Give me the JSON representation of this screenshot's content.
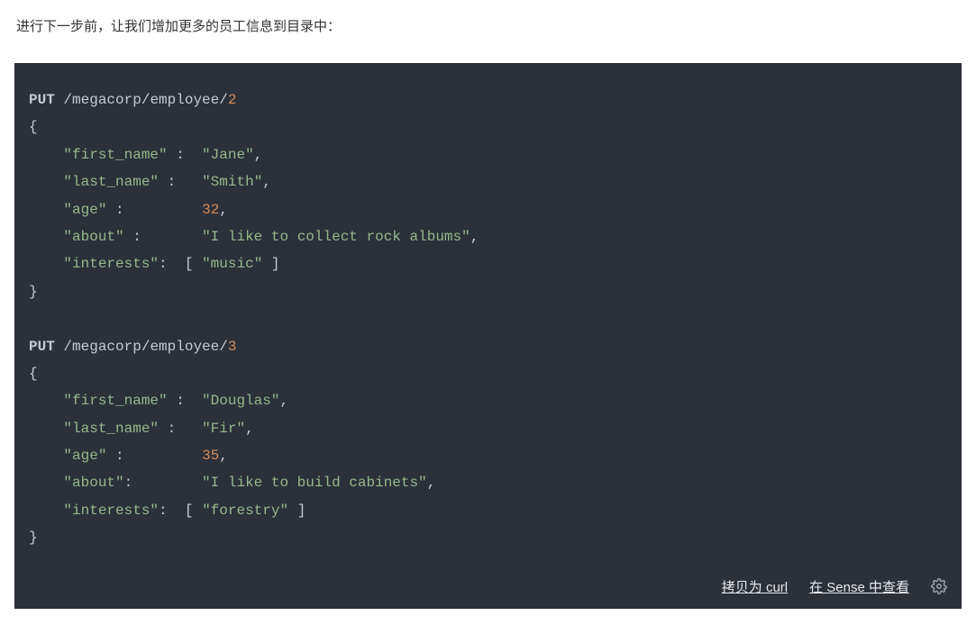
{
  "intro_text": "进行下一步前，让我们增加更多的员工信息到目录中：",
  "code": {
    "method": "PUT",
    "base_path": "/megacorp/employee/",
    "entries": [
      {
        "id": "2",
        "fields": {
          "first_name": "Jane",
          "last_name": "Smith",
          "age": 32,
          "about": "I like to collect rock albums",
          "interests": [
            "music"
          ]
        }
      },
      {
        "id": "3",
        "fields": {
          "first_name": "Douglas",
          "last_name": "Fir",
          "age": 35,
          "about": "I like to build cabinets",
          "interests": [
            "forestry"
          ]
        }
      }
    ]
  },
  "toolbar": {
    "copy_curl": "拷贝为 curl",
    "view_sense": "在 Sense 中查看"
  }
}
